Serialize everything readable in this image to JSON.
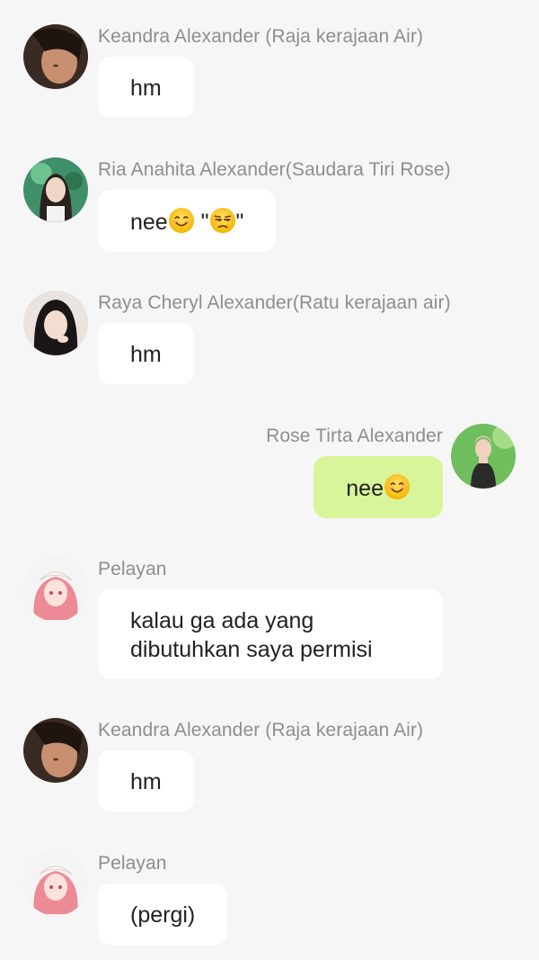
{
  "messages": [
    {
      "side": "left",
      "sender": "Keandra Alexander (Raja kerajaan Air)",
      "text": "hm",
      "avatar": "avatar-keandra"
    },
    {
      "side": "left",
      "sender": "Ria Anahita Alexander(Saudara Tiri Rose)",
      "text_before": "nee",
      "text_mid": " \"",
      "text_after": "\"",
      "avatar": "avatar-ria",
      "emojis": [
        "smiling-face-emoji",
        "unamused-face-emoji"
      ]
    },
    {
      "side": "left",
      "sender": "Raya Cheryl Alexander(Ratu kerajaan air)",
      "text": "hm",
      "avatar": "avatar-raya"
    },
    {
      "side": "right",
      "sender": "Rose Tirta Alexander",
      "text": "nee",
      "avatar": "avatar-rose",
      "emojis": [
        "smiling-face-emoji"
      ]
    },
    {
      "side": "left",
      "sender": "Pelayan",
      "text": "kalau ga ada yang dibutuhkan saya permisi",
      "avatar": "avatar-pelayan"
    },
    {
      "side": "left",
      "sender": "Keandra Alexander (Raja kerajaan Air)",
      "text": "hm",
      "avatar": "avatar-keandra"
    },
    {
      "side": "left",
      "sender": "Pelayan",
      "text": "(pergi)",
      "avatar": "avatar-pelayan"
    }
  ],
  "colors": {
    "background": "#f6f6f6",
    "bubble_other": "#ffffff",
    "bubble_self": "#d9f59a",
    "name_text": "#8e8e8e"
  }
}
